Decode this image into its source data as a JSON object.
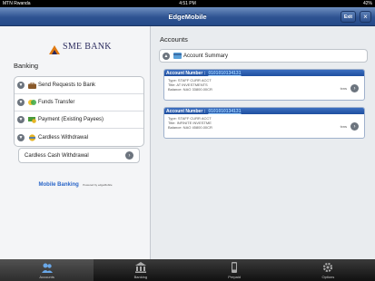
{
  "status": {
    "carrier": "MTN Rwanda",
    "time": "4:51 PM",
    "battery": "42%"
  },
  "nav": {
    "title": "EdgeMobile",
    "exit": "Exit",
    "close": "×"
  },
  "bank": {
    "name": "SME BANK"
  },
  "banking": {
    "title": "Banking",
    "items": [
      {
        "label": "Send Requests to Bank"
      },
      {
        "label": "Funds Transfer"
      },
      {
        "label": "Payment (Existing Payees)"
      },
      {
        "label": "Cardless Withdrawal"
      }
    ],
    "cardless_button": "Cardless Cash Withdrawal"
  },
  "powered": {
    "product": "Mobile Banking",
    "by": "Powered by edgeMobile"
  },
  "accounts": {
    "title": "Accounts",
    "summary_label": "Account Summary",
    "list": [
      {
        "header": "Account Number :",
        "number": "0101010134131",
        "type": "Type: STAFF CURR ACCT",
        "title": "Title: AT INVESTMENTS",
        "balance": "Balance: NAO 33800.00CR",
        "tag": "txns"
      },
      {
        "header": "Account Number :",
        "number": "0101010134131",
        "type": "Type: STAFF CURR ACCT",
        "title": "Title: INFINITE INVESTME",
        "balance": "Balance: NAO 45800.00CR",
        "tag": "txns"
      }
    ]
  },
  "tabs": [
    {
      "label": "Accounts",
      "icon": "accounts-icon"
    },
    {
      "label": "Banking",
      "icon": "banking-icon"
    },
    {
      "label": "Prepaid",
      "icon": "prepaid-icon"
    },
    {
      "label": "Options",
      "icon": "options-icon"
    }
  ],
  "colors": {
    "nav": "#2e5392",
    "link": "#2a66c8",
    "accent": "#3c6fc0"
  }
}
